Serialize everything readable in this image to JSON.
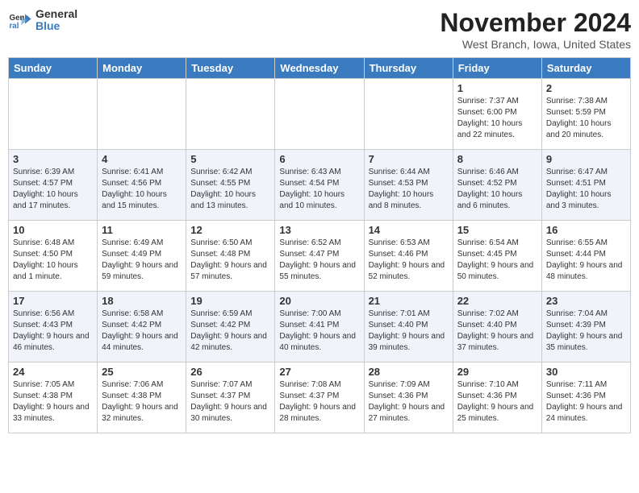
{
  "logo": {
    "general": "General",
    "blue": "Blue"
  },
  "title": "November 2024",
  "location": "West Branch, Iowa, United States",
  "weekdays": [
    "Sunday",
    "Monday",
    "Tuesday",
    "Wednesday",
    "Thursday",
    "Friday",
    "Saturday"
  ],
  "weeks": [
    [
      {
        "day": "",
        "info": ""
      },
      {
        "day": "",
        "info": ""
      },
      {
        "day": "",
        "info": ""
      },
      {
        "day": "",
        "info": ""
      },
      {
        "day": "",
        "info": ""
      },
      {
        "day": "1",
        "info": "Sunrise: 7:37 AM\nSunset: 6:00 PM\nDaylight: 10 hours and 22 minutes."
      },
      {
        "day": "2",
        "info": "Sunrise: 7:38 AM\nSunset: 5:59 PM\nDaylight: 10 hours and 20 minutes."
      }
    ],
    [
      {
        "day": "3",
        "info": "Sunrise: 6:39 AM\nSunset: 4:57 PM\nDaylight: 10 hours and 17 minutes."
      },
      {
        "day": "4",
        "info": "Sunrise: 6:41 AM\nSunset: 4:56 PM\nDaylight: 10 hours and 15 minutes."
      },
      {
        "day": "5",
        "info": "Sunrise: 6:42 AM\nSunset: 4:55 PM\nDaylight: 10 hours and 13 minutes."
      },
      {
        "day": "6",
        "info": "Sunrise: 6:43 AM\nSunset: 4:54 PM\nDaylight: 10 hours and 10 minutes."
      },
      {
        "day": "7",
        "info": "Sunrise: 6:44 AM\nSunset: 4:53 PM\nDaylight: 10 hours and 8 minutes."
      },
      {
        "day": "8",
        "info": "Sunrise: 6:46 AM\nSunset: 4:52 PM\nDaylight: 10 hours and 6 minutes."
      },
      {
        "day": "9",
        "info": "Sunrise: 6:47 AM\nSunset: 4:51 PM\nDaylight: 10 hours and 3 minutes."
      }
    ],
    [
      {
        "day": "10",
        "info": "Sunrise: 6:48 AM\nSunset: 4:50 PM\nDaylight: 10 hours and 1 minute."
      },
      {
        "day": "11",
        "info": "Sunrise: 6:49 AM\nSunset: 4:49 PM\nDaylight: 9 hours and 59 minutes."
      },
      {
        "day": "12",
        "info": "Sunrise: 6:50 AM\nSunset: 4:48 PM\nDaylight: 9 hours and 57 minutes."
      },
      {
        "day": "13",
        "info": "Sunrise: 6:52 AM\nSunset: 4:47 PM\nDaylight: 9 hours and 55 minutes."
      },
      {
        "day": "14",
        "info": "Sunrise: 6:53 AM\nSunset: 4:46 PM\nDaylight: 9 hours and 52 minutes."
      },
      {
        "day": "15",
        "info": "Sunrise: 6:54 AM\nSunset: 4:45 PM\nDaylight: 9 hours and 50 minutes."
      },
      {
        "day": "16",
        "info": "Sunrise: 6:55 AM\nSunset: 4:44 PM\nDaylight: 9 hours and 48 minutes."
      }
    ],
    [
      {
        "day": "17",
        "info": "Sunrise: 6:56 AM\nSunset: 4:43 PM\nDaylight: 9 hours and 46 minutes."
      },
      {
        "day": "18",
        "info": "Sunrise: 6:58 AM\nSunset: 4:42 PM\nDaylight: 9 hours and 44 minutes."
      },
      {
        "day": "19",
        "info": "Sunrise: 6:59 AM\nSunset: 4:42 PM\nDaylight: 9 hours and 42 minutes."
      },
      {
        "day": "20",
        "info": "Sunrise: 7:00 AM\nSunset: 4:41 PM\nDaylight: 9 hours and 40 minutes."
      },
      {
        "day": "21",
        "info": "Sunrise: 7:01 AM\nSunset: 4:40 PM\nDaylight: 9 hours and 39 minutes."
      },
      {
        "day": "22",
        "info": "Sunrise: 7:02 AM\nSunset: 4:40 PM\nDaylight: 9 hours and 37 minutes."
      },
      {
        "day": "23",
        "info": "Sunrise: 7:04 AM\nSunset: 4:39 PM\nDaylight: 9 hours and 35 minutes."
      }
    ],
    [
      {
        "day": "24",
        "info": "Sunrise: 7:05 AM\nSunset: 4:38 PM\nDaylight: 9 hours and 33 minutes."
      },
      {
        "day": "25",
        "info": "Sunrise: 7:06 AM\nSunset: 4:38 PM\nDaylight: 9 hours and 32 minutes."
      },
      {
        "day": "26",
        "info": "Sunrise: 7:07 AM\nSunset: 4:37 PM\nDaylight: 9 hours and 30 minutes."
      },
      {
        "day": "27",
        "info": "Sunrise: 7:08 AM\nSunset: 4:37 PM\nDaylight: 9 hours and 28 minutes."
      },
      {
        "day": "28",
        "info": "Sunrise: 7:09 AM\nSunset: 4:36 PM\nDaylight: 9 hours and 27 minutes."
      },
      {
        "day": "29",
        "info": "Sunrise: 7:10 AM\nSunset: 4:36 PM\nDaylight: 9 hours and 25 minutes."
      },
      {
        "day": "30",
        "info": "Sunrise: 7:11 AM\nSunset: 4:36 PM\nDaylight: 9 hours and 24 minutes."
      }
    ]
  ]
}
